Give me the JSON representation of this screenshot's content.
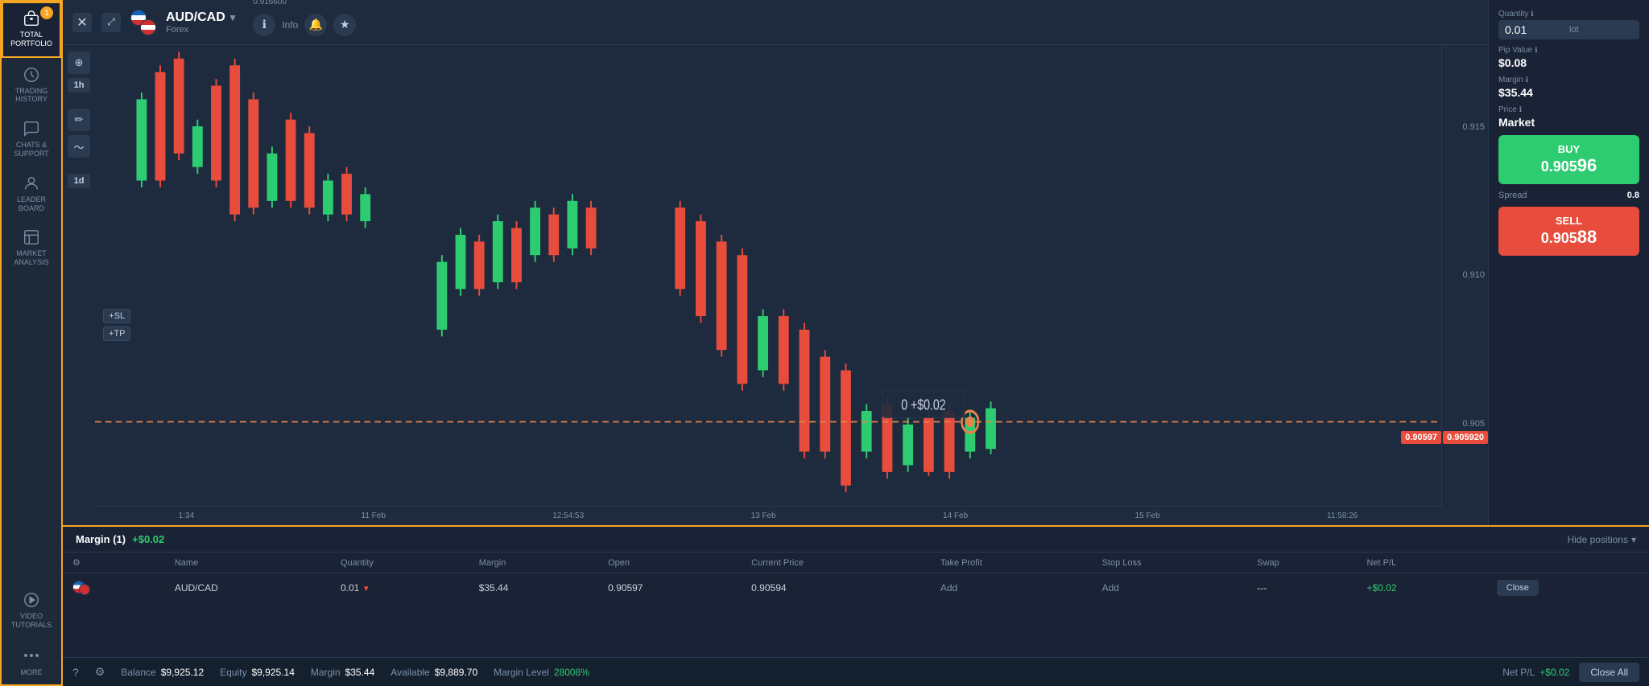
{
  "sidebar": {
    "items": [
      {
        "id": "total-portfolio",
        "label": "TOTAL\nPORTFOLIO",
        "icon": "portfolio",
        "active": true,
        "badge": "1"
      },
      {
        "id": "trading-history",
        "label": "TRADING\nHISTORY",
        "icon": "clock",
        "active": false
      },
      {
        "id": "chats-support",
        "label": "CHATS &\nSUPPORT",
        "icon": "chat",
        "active": false
      },
      {
        "id": "leaderboard",
        "label": "LEADER\nBOARD",
        "icon": "leaderboard",
        "active": false
      },
      {
        "id": "market-analysis",
        "label": "MARKET\nANALYSIS",
        "icon": "chart",
        "active": false
      },
      {
        "id": "video-tutorials",
        "label": "VIDEO\nTUTORIALS",
        "icon": "play",
        "active": false
      },
      {
        "id": "more",
        "label": "MORE",
        "icon": "dots",
        "active": false
      }
    ]
  },
  "header": {
    "pair": "AUD/CAD",
    "pair_type": "Forex",
    "price_overlay": "0.916600",
    "info_label": "Info"
  },
  "chart": {
    "timeframes": [
      "1h",
      "1d"
    ],
    "price_levels": [
      "0.915",
      "0.910",
      "0.905"
    ],
    "dates": [
      "11 Feb",
      "12:54:53",
      "13 Feb",
      "14 Feb",
      "15 Feb",
      "11:58:26"
    ],
    "dashed_line_price": "0.90597",
    "position_tooltip": "0  +$0.02",
    "price_tag_right": "0.90597",
    "price_tag_right2": "0.905920"
  },
  "order_panel": {
    "quantity_label": "Quantity",
    "quantity_value": "0.01",
    "quantity_unit": "lot",
    "pip_label": "Pip Value",
    "pip_value": "$0.08",
    "margin_label": "Margin",
    "margin_value": "$35.44",
    "price_label": "Price",
    "price_value": "Market",
    "buy_label": "BUY",
    "buy_price": "0.905​96",
    "sell_label": "SELL",
    "sell_price": "0.905​88",
    "spread_label": "Spread",
    "spread_value": "0.8"
  },
  "positions": {
    "header_margin": "Margin (1)",
    "header_profit": "+$0.02",
    "hide_label": "Hide positions",
    "columns": [
      "Name",
      "Quantity",
      "Margin",
      "Open",
      "Current Price",
      "Take Profit",
      "Stop Loss",
      "Swap",
      "Net P/L"
    ],
    "rows": [
      {
        "flag": "aud-cad",
        "name": "AUD/CAD",
        "quantity": "0.01",
        "direction": "down",
        "margin": "$35.44",
        "open": "0.90597",
        "current_price": "0.90594",
        "take_profit": "Add",
        "stop_loss": "Add",
        "swap": "---",
        "net_pl": "+$0.02",
        "action": "Close"
      }
    ]
  },
  "bottom_bar": {
    "balance_label": "Balance",
    "balance_value": "$9,925.12",
    "equity_label": "Equity",
    "equity_value": "$9,925.14",
    "margin_label": "Margin",
    "margin_value": "$35.44",
    "available_label": "Available",
    "available_value": "$9,889.70",
    "margin_level_label": "Margin Level",
    "margin_level_value": "28008%",
    "net_pl_label": "Net P/L",
    "net_pl_value": "+$0.02",
    "close_all_label": "Close All"
  }
}
